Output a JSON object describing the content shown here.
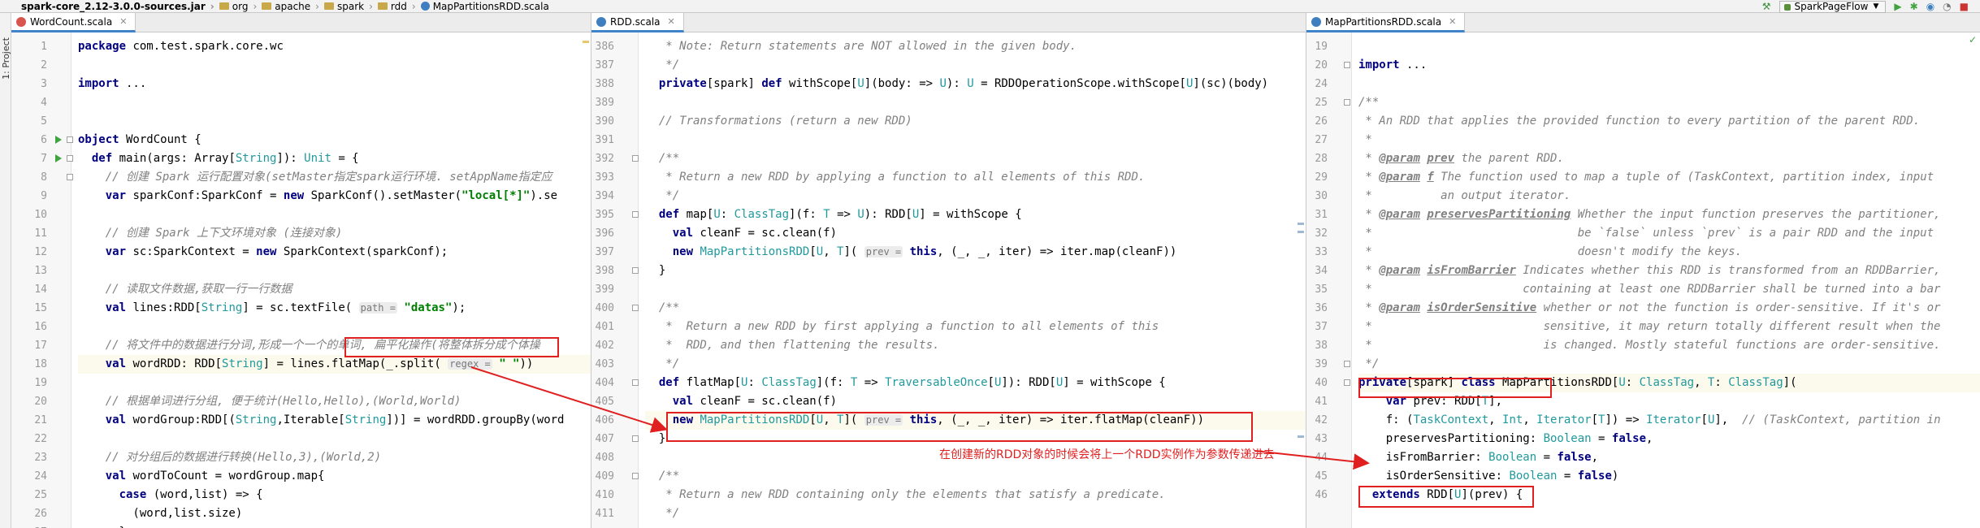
{
  "navbar": {
    "breadcrumbs": [
      "spark-core_2.12-3.0.0-sources.jar",
      "org",
      "apache",
      "spark",
      "rdd",
      "MapPartitionsRDD.scala"
    ],
    "run_config": "SparkPageFlow"
  },
  "tool_window": {
    "project_label": "1: Project"
  },
  "panes": {
    "left": {
      "tab_label": "WordCount.scala",
      "lines": [
        {
          "n": "1",
          "t": "package com.test.spark.core.wc"
        },
        {
          "n": "2",
          "t": ""
        },
        {
          "n": "3",
          "t": "import ..."
        },
        {
          "n": "4",
          "t": ""
        },
        {
          "n": "5",
          "t": ""
        },
        {
          "n": "6",
          "t": "object WordCount {"
        },
        {
          "n": "7",
          "t": "  def main(args: Array[String]): Unit = {"
        },
        {
          "n": "8",
          "t": "    // 创建 Spark 运行配置对象(setMaster指定spark运行环境. setAppName指定应"
        },
        {
          "n": "9",
          "t": "    var sparkConf:SparkConf = new SparkConf().setMaster(\"local[*]\").se"
        },
        {
          "n": "10",
          "t": ""
        },
        {
          "n": "11",
          "t": "    // 创建 Spark 上下文环境对象 (连接对象)"
        },
        {
          "n": "12",
          "t": "    var sc:SparkContext = new SparkContext(sparkConf);"
        },
        {
          "n": "13",
          "t": ""
        },
        {
          "n": "14",
          "t": "    // 读取文件数据,获取一行一行数据"
        },
        {
          "n": "15",
          "t": "    val lines:RDD[String] = sc.textFile( path = \"datas\");"
        },
        {
          "n": "16",
          "t": ""
        },
        {
          "n": "17",
          "t": "    // 将文件中的数据进行分词,形成一个一个的单词, 扁平化操作(将整体拆分成个体操"
        },
        {
          "n": "18",
          "t": "    val wordRDD: RDD[String] = lines.flatMap(_.split( regex = \" \"))"
        },
        {
          "n": "19",
          "t": ""
        },
        {
          "n": "20",
          "t": "    // 根据单词进行分组, 便于统计(Hello,Hello),(World,World)"
        },
        {
          "n": "21",
          "t": "    val wordGroup:RDD[(String,Iterable[String])] = wordRDD.groupBy(word"
        },
        {
          "n": "22",
          "t": ""
        },
        {
          "n": "23",
          "t": "    // 对分组后的数据进行转换(Hello,3),(World,2)"
        },
        {
          "n": "24",
          "t": "    val wordToCount = wordGroup.map{"
        },
        {
          "n": "25",
          "t": "      case (word,list) => {"
        },
        {
          "n": "26",
          "t": "        (word,list.size)"
        },
        {
          "n": "27",
          "t": "      }"
        }
      ]
    },
    "middle": {
      "tab_label": "RDD.scala",
      "lines": [
        {
          "n": "386",
          "t": "   * Note: Return statements are NOT allowed in the given body."
        },
        {
          "n": "387",
          "t": "   */"
        },
        {
          "n": "388",
          "t": "  private[spark] def withScope[U](body: => U): U = RDDOperationScope.withScope[U](sc)(body)"
        },
        {
          "n": "389",
          "t": ""
        },
        {
          "n": "390",
          "t": "  // Transformations (return a new RDD)"
        },
        {
          "n": "391",
          "t": ""
        },
        {
          "n": "392",
          "t": "  /**"
        },
        {
          "n": "393",
          "t": "   * Return a new RDD by applying a function to all elements of this RDD."
        },
        {
          "n": "394",
          "t": "   */"
        },
        {
          "n": "395",
          "t": "  def map[U: ClassTag](f: T => U): RDD[U] = withScope {"
        },
        {
          "n": "396",
          "t": "    val cleanF = sc.clean(f)"
        },
        {
          "n": "397",
          "t": "    new MapPartitionsRDD[U, T]( prev = this, (_, _, iter) => iter.map(cleanF))"
        },
        {
          "n": "398",
          "t": "  }"
        },
        {
          "n": "399",
          "t": ""
        },
        {
          "n": "400",
          "t": "  /**"
        },
        {
          "n": "401",
          "t": "   *  Return a new RDD by first applying a function to all elements of this"
        },
        {
          "n": "402",
          "t": "   *  RDD, and then flattening the results."
        },
        {
          "n": "403",
          "t": "   */"
        },
        {
          "n": "404",
          "t": "  def flatMap[U: ClassTag](f: T => TraversableOnce[U]): RDD[U] = withScope {"
        },
        {
          "n": "405",
          "t": "    val cleanF = sc.clean(f)"
        },
        {
          "n": "406",
          "t": "    new MapPartitionsRDD[U, T]( prev = this, (_, _, iter) => iter.flatMap(cleanF))"
        },
        {
          "n": "407",
          "t": "  }"
        },
        {
          "n": "408",
          "t": ""
        },
        {
          "n": "409",
          "t": "  /**"
        },
        {
          "n": "410",
          "t": "   * Return a new RDD containing only the elements that satisfy a predicate."
        },
        {
          "n": "411",
          "t": "   */"
        }
      ]
    },
    "right": {
      "tab_label": "MapPartitionsRDD.scala",
      "lines": [
        {
          "n": "19",
          "t": ""
        },
        {
          "n": "20",
          "t": "import ..."
        },
        {
          "n": "24",
          "t": ""
        },
        {
          "n": "25",
          "t": "/**"
        },
        {
          "n": "26",
          "t": " * An RDD that applies the provided function to every partition of the parent RDD."
        },
        {
          "n": "27",
          "t": " *"
        },
        {
          "n": "28",
          "t": " * @param prev the parent RDD."
        },
        {
          "n": "29",
          "t": " * @param f The function used to map a tuple of (TaskContext, partition index, input"
        },
        {
          "n": "30",
          "t": " *          an output iterator."
        },
        {
          "n": "31",
          "t": " * @param preservesPartitioning Whether the input function preserves the partitioner,"
        },
        {
          "n": "32",
          "t": " *                              be `false` unless `prev` is a pair RDD and the input"
        },
        {
          "n": "33",
          "t": " *                              doesn't modify the keys."
        },
        {
          "n": "34",
          "t": " * @param isFromBarrier Indicates whether this RDD is transformed from an RDDBarrier,"
        },
        {
          "n": "35",
          "t": " *                      containing at least one RDDBarrier shall be turned into a bar"
        },
        {
          "n": "36",
          "t": " * @param isOrderSensitive whether or not the function is order-sensitive. If it's or"
        },
        {
          "n": "37",
          "t": " *                         sensitive, it may return totally different result when the"
        },
        {
          "n": "38",
          "t": " *                         is changed. Mostly stateful functions are order-sensitive."
        },
        {
          "n": "39",
          "t": " */"
        },
        {
          "n": "40",
          "t": "private[spark] class MapPartitionsRDD[U: ClassTag, T: ClassTag]("
        },
        {
          "n": "41",
          "t": "    var prev: RDD[T],"
        },
        {
          "n": "42",
          "t": "    f: (TaskContext, Int, Iterator[T]) => Iterator[U],  // (TaskContext, partition in"
        },
        {
          "n": "43",
          "t": "    preservesPartitioning: Boolean = false,"
        },
        {
          "n": "44",
          "t": "    isFromBarrier: Boolean = false,"
        },
        {
          "n": "45",
          "t": "    isOrderSensitive: Boolean = false)"
        },
        {
          "n": "46",
          "t": "  extends RDD[U](prev) {"
        }
      ]
    }
  },
  "annotation": {
    "text": "在创建新的RDD对象的时候会将上一个RDD实例作为参数传递进去",
    "color": "#e02020"
  }
}
